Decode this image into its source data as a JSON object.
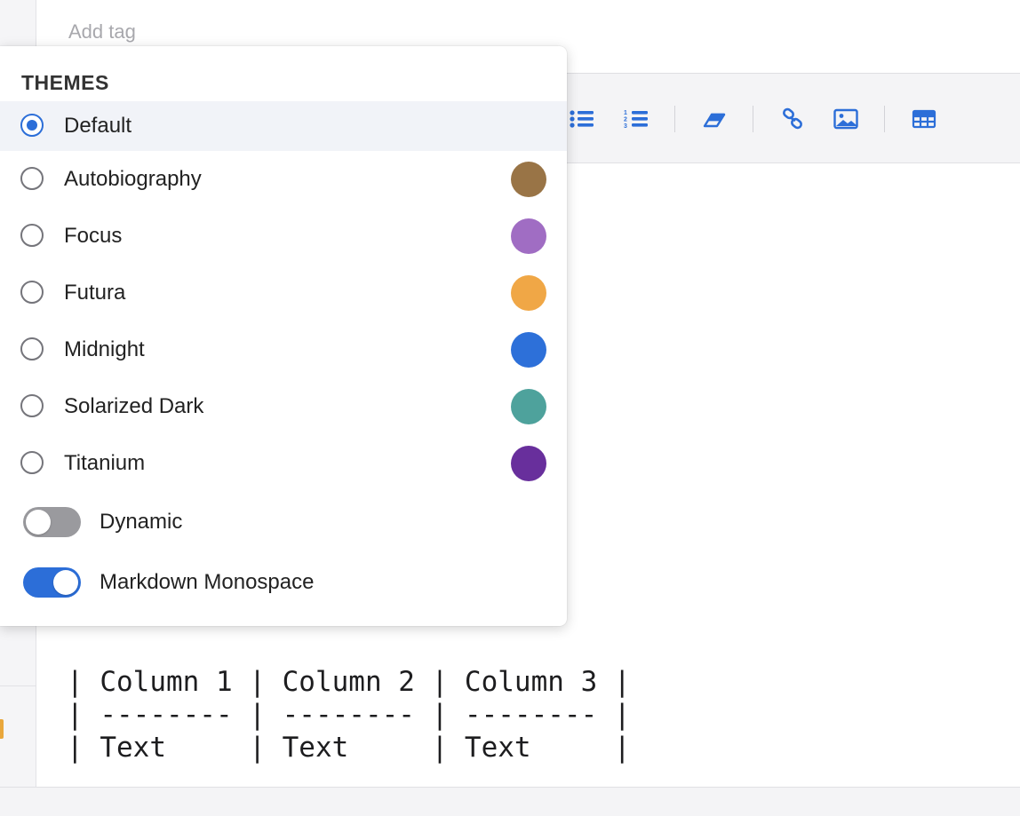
{
  "tags": {
    "placeholder": "Add tag"
  },
  "themes": {
    "title": "THEMES",
    "items": [
      {
        "label": "Default",
        "selected": true,
        "color": null
      },
      {
        "label": "Autobiography",
        "selected": false,
        "color": "#997446"
      },
      {
        "label": "Focus",
        "selected": false,
        "color": "#a06dc3"
      },
      {
        "label": "Futura",
        "selected": false,
        "color": "#f0a746"
      },
      {
        "label": "Midnight",
        "selected": false,
        "color": "#2d70d9"
      },
      {
        "label": "Solarized Dark",
        "selected": false,
        "color": "#4ea29c"
      },
      {
        "label": "Titanium",
        "selected": false,
        "color": "#682f9c"
      }
    ],
    "toggles": [
      {
        "label": "Dynamic",
        "on": false
      },
      {
        "label": "Markdown Monospace",
        "on": true
      }
    ]
  },
  "toolbar": {
    "accent": "#2c6ed8",
    "icons": [
      "bulleted-list-icon",
      "numbered-list-icon",
      "eraser-icon",
      "link-icon",
      "image-icon",
      "table-icon"
    ]
  },
  "editor": {
    "table_lines": [
      "| Column 1 | Column 2 | Column 3 |",
      "| -------- | -------- | -------- |",
      "| Text     | Text     | Text     |"
    ]
  }
}
